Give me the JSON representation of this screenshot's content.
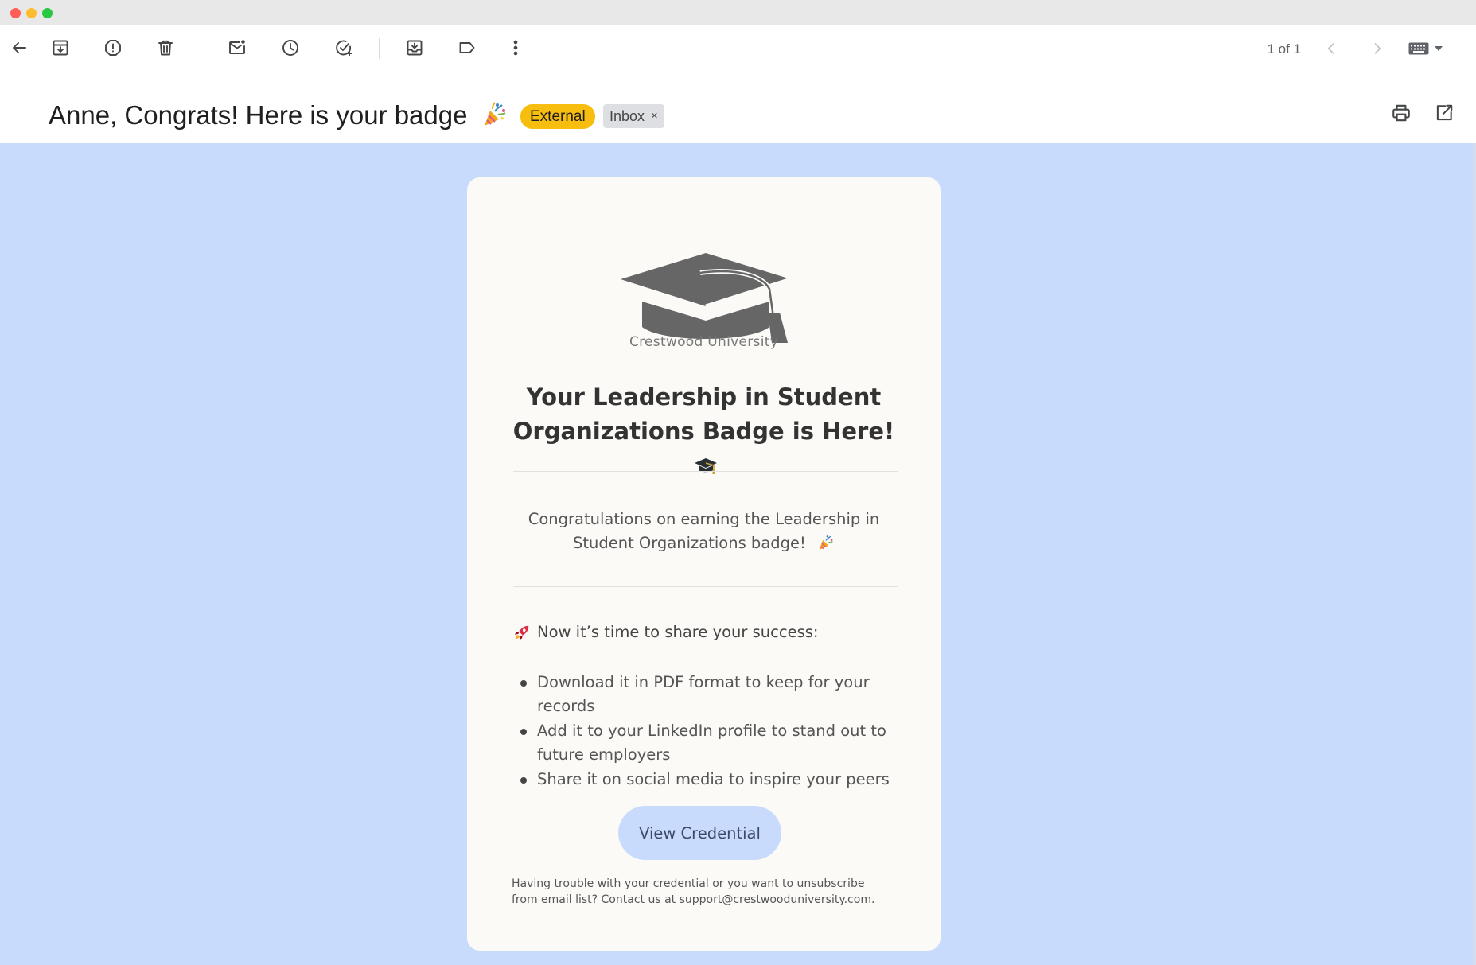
{
  "window": {
    "controls": [
      "close",
      "minimize",
      "maximize"
    ]
  },
  "toolbar": {
    "buttons": [
      {
        "name": "back-icon"
      },
      {
        "name": "archive-icon"
      },
      {
        "name": "report-spam-icon"
      },
      {
        "name": "delete-icon"
      },
      {
        "name": "mark-unread-icon"
      },
      {
        "name": "snooze-icon"
      },
      {
        "name": "add-task-icon"
      },
      {
        "name": "move-to-icon"
      },
      {
        "name": "label-icon"
      },
      {
        "name": "more-options-icon"
      }
    ],
    "pager": "1 of 1",
    "prev_icon": "chevron-left-icon",
    "next_icon": "chevron-right-icon",
    "keyboard_icon": "keyboard-icon"
  },
  "subject": {
    "text": "Anne, Congrats! Here is your badge",
    "emoji": "party-popper",
    "labels": {
      "external": "External",
      "inbox": "Inbox",
      "inbox_remove": "×"
    },
    "actions": [
      "print-icon",
      "open-new-window-icon"
    ]
  },
  "email": {
    "colors": {
      "background": "#c8dbfd",
      "card": "#fbfaf7",
      "button": "#c8dbfd"
    },
    "logo": {
      "icon": "graduation-cap-icon",
      "name": "Crestwood University"
    },
    "title": "Your Leadership in Student Organizations Badge is Here!",
    "title_emoji": "graduation-cap",
    "congrats": "Congratulations on earning the Leadership in Student Organizations badge!",
    "congrats_emoji": "party-popper",
    "share_intro": "Now it’s time to share your success:",
    "share_emoji": "rocket",
    "bullets": [
      "Download it in PDF format to keep for your records",
      "Add it to your LinkedIn profile to stand out to future employers",
      "Share it on social media to inspire your peers"
    ],
    "cta": "View Credential",
    "footer": {
      "text": "Having trouble with your credential or you want to unsubscribe from email list? Contact us at ",
      "email": "support@crestwooduniversity.com",
      "end": "."
    }
  }
}
